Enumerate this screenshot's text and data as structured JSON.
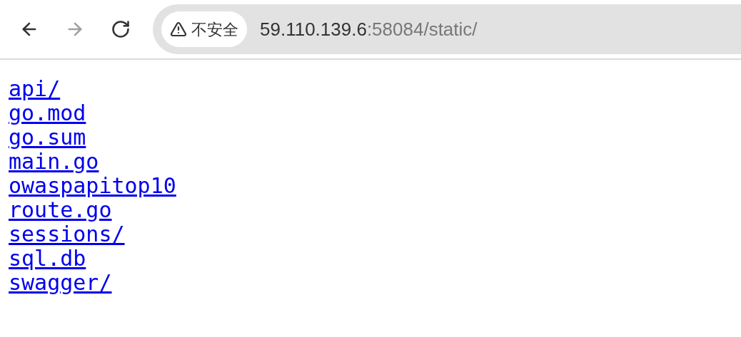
{
  "toolbar": {
    "nav_buttons": [
      {
        "kind": "back",
        "disabled": false
      },
      {
        "kind": "forward",
        "disabled": true
      },
      {
        "kind": "reload",
        "disabled": false
      }
    ],
    "security_chip": {
      "label": "不安全"
    },
    "address": {
      "host": "59.110.139.6",
      "rest": ":58084/static/"
    }
  },
  "listing": [
    "api/",
    "go.mod",
    "go.sum",
    "main.go",
    "owaspapitop10",
    "route.go",
    "sessions/",
    "sql.db",
    "swagger/"
  ]
}
